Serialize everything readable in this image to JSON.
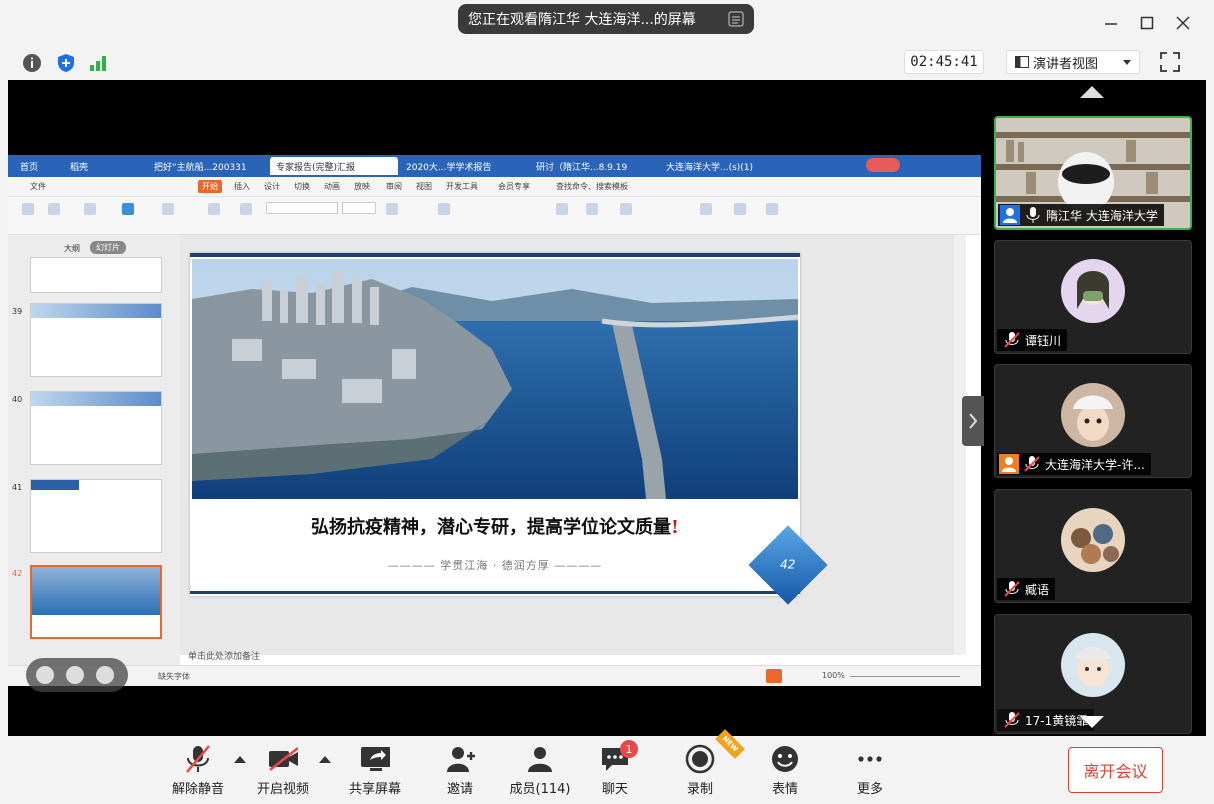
{
  "share": {
    "banner": "您正在观看隋江华 大连海洋...的屏幕"
  },
  "header": {
    "timer": "02:45:41",
    "view_label": "演讲者视图"
  },
  "wps": {
    "tabs": [
      "首页",
      "稻壳",
      "把好“主航船...200331",
      "专家报告(完整)汇报",
      "2020大...学学术报告",
      "研讨（隋江华...8.9.19",
      "大连海洋大学...(s)(1)"
    ],
    "menu": [
      "文件",
      "开始",
      "插入",
      "设计",
      "切换",
      "动画",
      "放映",
      "审阅",
      "视图",
      "开发工具",
      "会员专享",
      "查找命令、搜索模板"
    ],
    "panel_tabs": [
      "大纲",
      "幻灯片"
    ],
    "thumb_numbers": [
      "39",
      "40",
      "41",
      "42"
    ],
    "slide": {
      "title": "弘扬抗疫精神，潜心专研，提高学位论文质量",
      "exclaim": "!",
      "sub_left": "学贯江海",
      "sub_right": "德润方厚",
      "page_no": "42"
    },
    "notes": "单击此处添加备注",
    "status_left": "缺失字体",
    "zoom": "100%"
  },
  "participants": [
    {
      "name": "隋江华 大连海洋大学",
      "active": true
    },
    {
      "name": "谭钰川"
    },
    {
      "name": "大连海洋大学-许..."
    },
    {
      "name": "臧语"
    },
    {
      "name": "17-1黄镜霏"
    }
  ],
  "toolbar": {
    "unmute": "解除静音",
    "video": "开启视频",
    "share": "共享屏幕",
    "invite": "邀请",
    "members": "成员(114)",
    "chat": "聊天",
    "chat_badge": "1",
    "record": "录制",
    "new_tag": "NEW",
    "react": "表情",
    "more": "更多",
    "leave": "离开会议"
  },
  "colors": {
    "accent_blue": "#2a64b9",
    "leave_red": "#e0412f",
    "active_green": "#3bb34a"
  }
}
